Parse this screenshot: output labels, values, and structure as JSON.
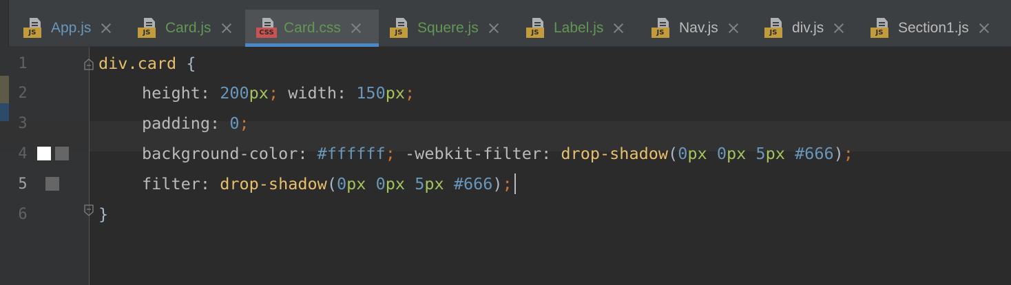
{
  "tabs": [
    {
      "label": "App.js",
      "type": "js",
      "color": "#6897bb",
      "active": false
    },
    {
      "label": "Card.js",
      "type": "js",
      "color": "#629755",
      "active": false
    },
    {
      "label": "Card.css",
      "type": "css",
      "color": "#629755",
      "active": true
    },
    {
      "label": "Squere.js",
      "type": "js",
      "color": "#629755",
      "active": false
    },
    {
      "label": "Label.js",
      "type": "js",
      "color": "#629755",
      "active": false
    },
    {
      "label": "Nav.js",
      "type": "js",
      "color": "#bbbbbb",
      "active": false
    },
    {
      "label": "div.js",
      "type": "js",
      "color": "#bbbbbb",
      "active": false
    },
    {
      "label": "Section1.js",
      "type": "js",
      "color": "#bbbbbb",
      "active": false
    }
  ],
  "icons": {
    "js_badge": "JS",
    "css_badge": "CSS"
  },
  "editor": {
    "line_numbers": [
      "1",
      "2",
      "3",
      "4",
      "5",
      "6"
    ],
    "current_line": "5",
    "swatches": {
      "line4": [
        "#ffffff",
        "#666666"
      ],
      "line5": [
        "#666666"
      ]
    },
    "code": {
      "l1": {
        "selector": "div.card",
        "brace": " {"
      },
      "l2": {
        "p1": "height",
        "c1": ": ",
        "n1": "200",
        "u1": "px",
        "s1": ";",
        "p2": " width",
        "c2": ": ",
        "n2": "150",
        "u2": "px",
        "s2": ";"
      },
      "l3": {
        "p1": "padding",
        "c1": ": ",
        "n1": "0",
        "s1": ";"
      },
      "l4": {
        "p1": "background-color",
        "c1": ": ",
        "h1": "#ffffff",
        "s1": ";",
        "p2": " -webkit-filter",
        "c2": ": ",
        "f1": "drop-shadow",
        "o1": "(",
        "n1": "0",
        "u1": "px",
        "sp1": " ",
        "n2": "0",
        "u2": "px",
        "sp2": " ",
        "n3": "5",
        "u3": "px",
        "sp3": " ",
        "h2": "#666",
        "o2": ")",
        "s2": ";"
      },
      "l5": {
        "p1": "filter",
        "c1": ": ",
        "f1": "drop-shadow",
        "o1": "(",
        "n1": "0",
        "u1": "px",
        "sp1": " ",
        "n2": "0",
        "u2": "px",
        "sp2": " ",
        "n3": "5",
        "u3": "px",
        "sp3": " ",
        "h1": "#666",
        "o2": ")",
        "s1": ";"
      },
      "l6": {
        "brace": "}"
      }
    }
  },
  "colors": {
    "accent": "#4a88c7",
    "background": "#2b2b2b",
    "gutter": "#313335"
  }
}
